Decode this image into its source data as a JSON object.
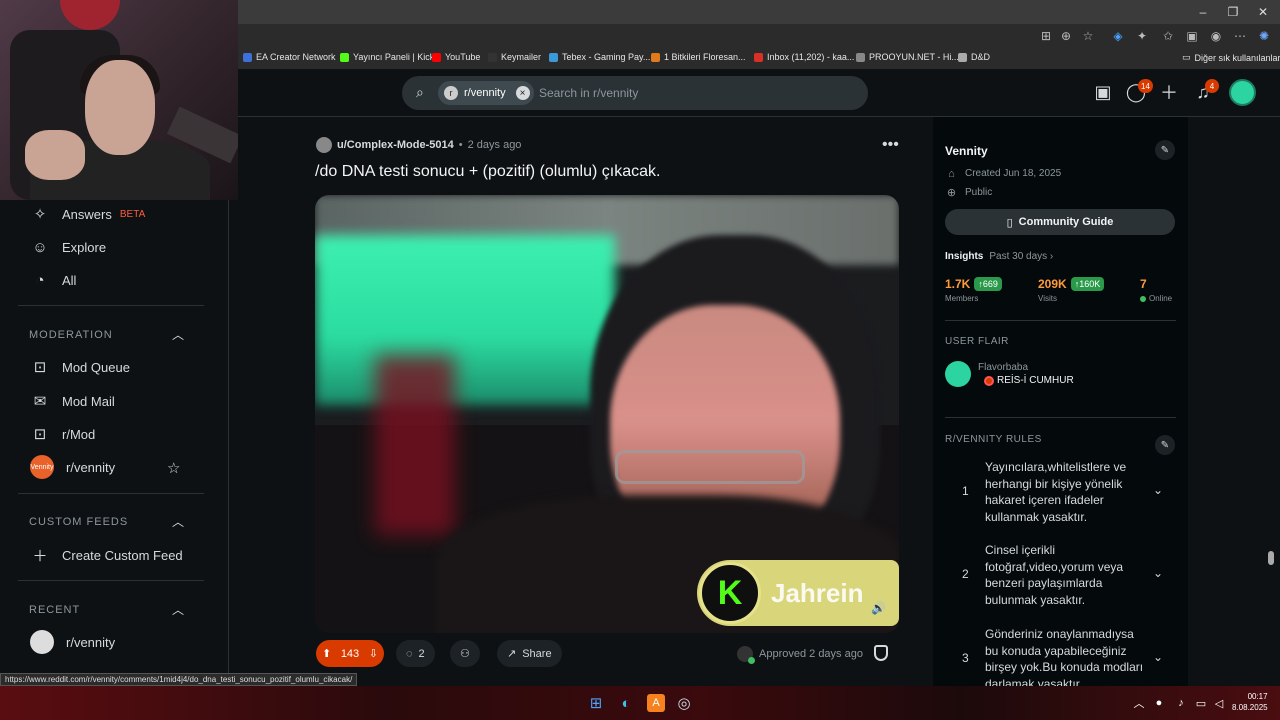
{
  "bookmarks": [
    {
      "label": "EA Creator Network",
      "color": "#3f6fd8"
    },
    {
      "label": "Yayıncı Paneli | Kick",
      "color": "#53fc18"
    },
    {
      "label": "YouTube",
      "color": "#ff0000"
    },
    {
      "label": "Keymailer",
      "color": "#333333"
    },
    {
      "label": "Tebex - Gaming Pay...",
      "color": "#3a9ad9"
    },
    {
      "label": "1 Bitkileri Floresan...",
      "color": "#e07a1a"
    },
    {
      "label": "Inbox (11,202) - kaa...",
      "color": "#d93025"
    },
    {
      "label": "PROOYUN.NET - Hi...",
      "color": "#888888"
    },
    {
      "label": "D&D",
      "color": "#aaaaaa"
    }
  ],
  "bookmarks_other": "Diğer sık kullanılanlar",
  "search": {
    "chip_label": "r/vennity",
    "placeholder": "Search in r/vennity"
  },
  "header": {
    "chat_badge": "14",
    "notif_badge": "4"
  },
  "leftnav": {
    "answers": "Answers",
    "beta": "BETA",
    "explore": "Explore",
    "all": "All",
    "moderation_header": "MODERATION",
    "mod_queue": "Mod Queue",
    "mod_mail": "Mod Mail",
    "r_mod": "r/Mod",
    "r_vennity": "r/vennity",
    "custom_feeds_header": "CUSTOM FEEDS",
    "create_custom_feed": "Create Custom Feed",
    "recent_header": "RECENT",
    "recent_vennity": "r/vennity"
  },
  "status_url": "https://www.reddit.com/r/vennity/comments/1mid4j4/do_dna_testi_sonucu_pozitif_olumlu_cikacak/",
  "post": {
    "author": "u/Complex-Mode-5014",
    "separator": "•",
    "age": "2 days ago",
    "title": "/do DNA testi sonucu + (pozitif) (olumlu) çıkacak.",
    "watermark": "Jahrein",
    "upvotes": "143",
    "comments": "2",
    "share": "Share",
    "approved": "Approved 2 days ago"
  },
  "sidebar": {
    "name": "Vennity",
    "created": "Created Jun 18, 2025",
    "visibility": "Public",
    "guide_button": "Community Guide",
    "insights_label": "Insights",
    "insights_period": "Past 30 days ›",
    "stats": [
      {
        "value": "1.7K",
        "increase": "↑669",
        "label": "Members"
      },
      {
        "value": "209K",
        "increase": "↑160K",
        "label": "Visits"
      },
      {
        "value": "7",
        "increase": "",
        "label": "Online"
      }
    ],
    "user_flair_header": "USER FLAIR",
    "flair_user": "Flavorbaba",
    "flair_tag": "REİS-İ CUMHUR",
    "rules_header": "R/VENNITY RULES",
    "rules": [
      {
        "num": "1",
        "text": "Yayıncılara,whitelistlere ve herhangi bir kişiye yönelik hakaret içeren ifadeler kullanmak yasaktır."
      },
      {
        "num": "2",
        "text": "Cinsel içerikli fotoğraf,video,yorum veya benzeri paylaşımlarda bulunmak yasaktır."
      },
      {
        "num": "3",
        "text": "Gönderiniz onaylanmadıysa bu konuda yapabileceğiniz birşey yok.Bu konuda modları darlamak yasaktır."
      }
    ]
  },
  "taskbar": {
    "time": "00:17",
    "date": "8.08.2025"
  },
  "colors": {
    "accent": "#d93a00",
    "online": "#3fbf62",
    "kick_green": "#53fc18"
  }
}
